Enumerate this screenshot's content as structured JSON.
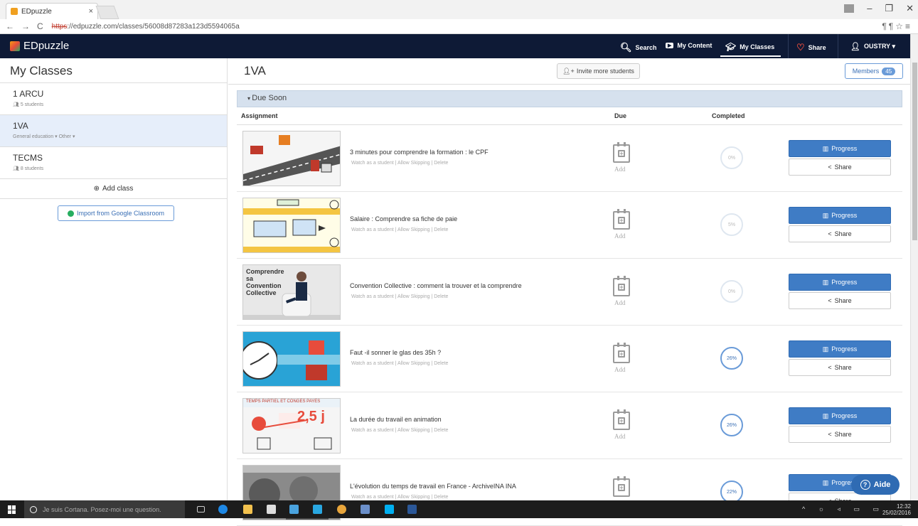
{
  "browser": {
    "tab_title": "EDpuzzle",
    "tab_close": "×",
    "url_scheme": "https",
    "url_rest": "://edpuzzle.com/classes/56008d87283a123d5594065a"
  },
  "navbar": {
    "logo": "EDpuzzle",
    "search": "Search",
    "my_content": "My Content",
    "my_classes": "My Classes",
    "share": "Share",
    "user": "OUSTRY ▾"
  },
  "sidebar": {
    "title": "My Classes",
    "classes": [
      {
        "name": "1 ARCU",
        "sub": "5 students"
      },
      {
        "name": "1VA",
        "sub": "General education  ▾   Other  ▾"
      },
      {
        "name": "TECMS",
        "sub": "8 students"
      }
    ],
    "add_class": "Add class",
    "import": "Import from Google Classroom"
  },
  "main": {
    "class_title": "1VA",
    "invite": "Invite more students",
    "members": "Members",
    "members_count": "45",
    "section": "Due Soon",
    "columns": {
      "assignment": "Assignment",
      "due": "Due",
      "completed": "Completed"
    },
    "links": "Watch as a student  |  Allow Skipping  |  Delete",
    "due_add": "Add",
    "progress_label": "Progress",
    "share_label": "Share",
    "assignments": [
      {
        "title": "3 minutes pour comprendre la formation : le CPF",
        "completed": "0%",
        "progress": 0
      },
      {
        "title": "Salaire : Comprendre sa fiche de paie",
        "completed": "5%",
        "progress": 0.05
      },
      {
        "title": "Convention Collective : comment la trouver et la comprendre",
        "completed": "0%",
        "progress": 0
      },
      {
        "title": "Faut -il sonner le glas des 35h ?",
        "completed": "26%",
        "progress": 0.26
      },
      {
        "title": "La durée du travail en animation",
        "completed": "26%",
        "progress": 0.26
      },
      {
        "title": "L'évolution du temps de travail en France - ArchiveINA INA",
        "completed": "22%",
        "progress": 0.22
      }
    ],
    "thumb_texts": {
      "t3": "Comprendre sa Convention Collective",
      "t5": "TEMPS PARTIEL ET CONGÉS PAYÉS",
      "t5b": "2,5 j"
    }
  },
  "aide": "Aide",
  "taskbar": {
    "cortana": "Je suis Cortana. Posez-moi une question.",
    "time": "12:32",
    "date": "25/02/2016"
  }
}
